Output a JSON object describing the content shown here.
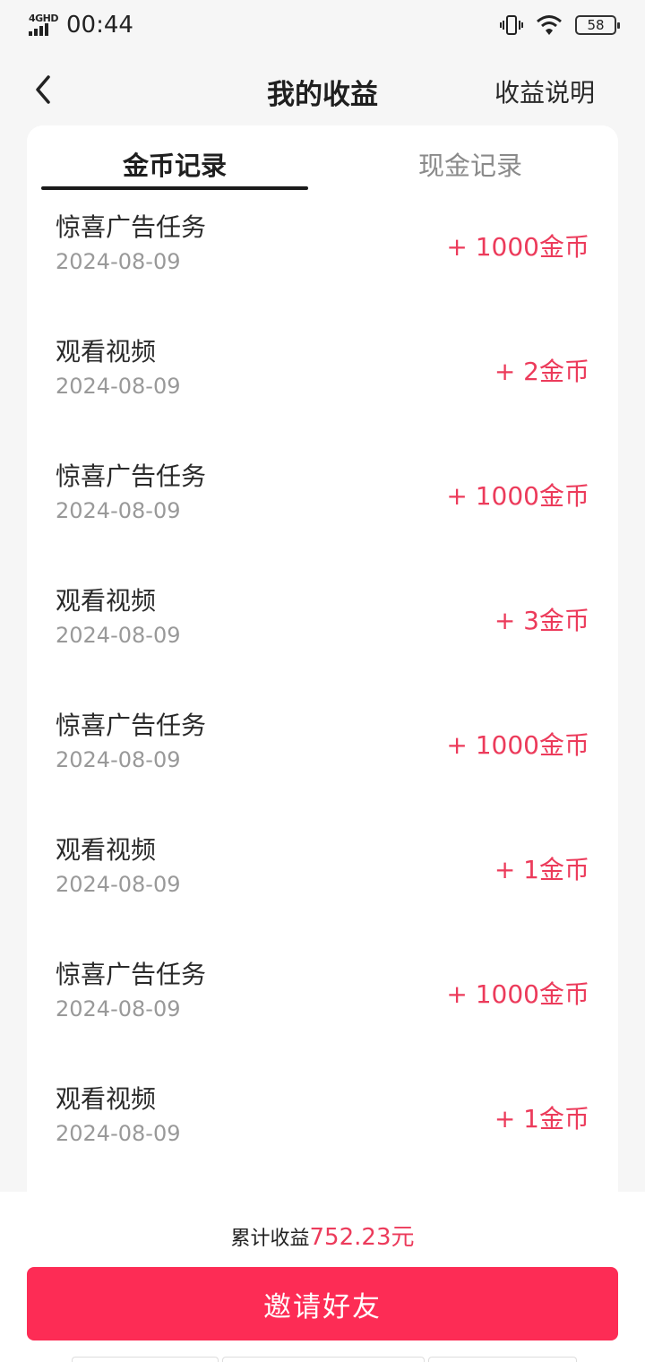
{
  "status_bar": {
    "network": "4GHD",
    "time": "00:44",
    "battery": "58",
    "icons": [
      "signal-icon",
      "vibrate-icon",
      "wifi-icon",
      "battery-icon"
    ]
  },
  "header": {
    "back_icon": "chevron-left-icon",
    "title": "我的收益",
    "explain_label": "收益说明"
  },
  "tabs": [
    {
      "label": "金币记录",
      "active": true
    },
    {
      "label": "现金记录",
      "active": false
    }
  ],
  "records": [
    {
      "title": "惊喜广告任务",
      "date": "2024-08-09",
      "amount": "+ 1000金币"
    },
    {
      "title": "观看视频",
      "date": "2024-08-09",
      "amount": "+ 2金币"
    },
    {
      "title": "惊喜广告任务",
      "date": "2024-08-09",
      "amount": "+ 1000金币"
    },
    {
      "title": "观看视频",
      "date": "2024-08-09",
      "amount": "+ 3金币"
    },
    {
      "title": "惊喜广告任务",
      "date": "2024-08-09",
      "amount": "+ 1000金币"
    },
    {
      "title": "观看视频",
      "date": "2024-08-09",
      "amount": "+ 1金币"
    },
    {
      "title": "惊喜广告任务",
      "date": "2024-08-09",
      "amount": "+ 1000金币"
    },
    {
      "title": "观看视频",
      "date": "2024-08-09",
      "amount": "+ 1金币"
    }
  ],
  "footer": {
    "total_label": "累计收益",
    "total_value": "752.23元",
    "invite_label": "邀请好友"
  },
  "colors": {
    "accent": "#fd2c55",
    "amount": "#ec3b5b"
  }
}
